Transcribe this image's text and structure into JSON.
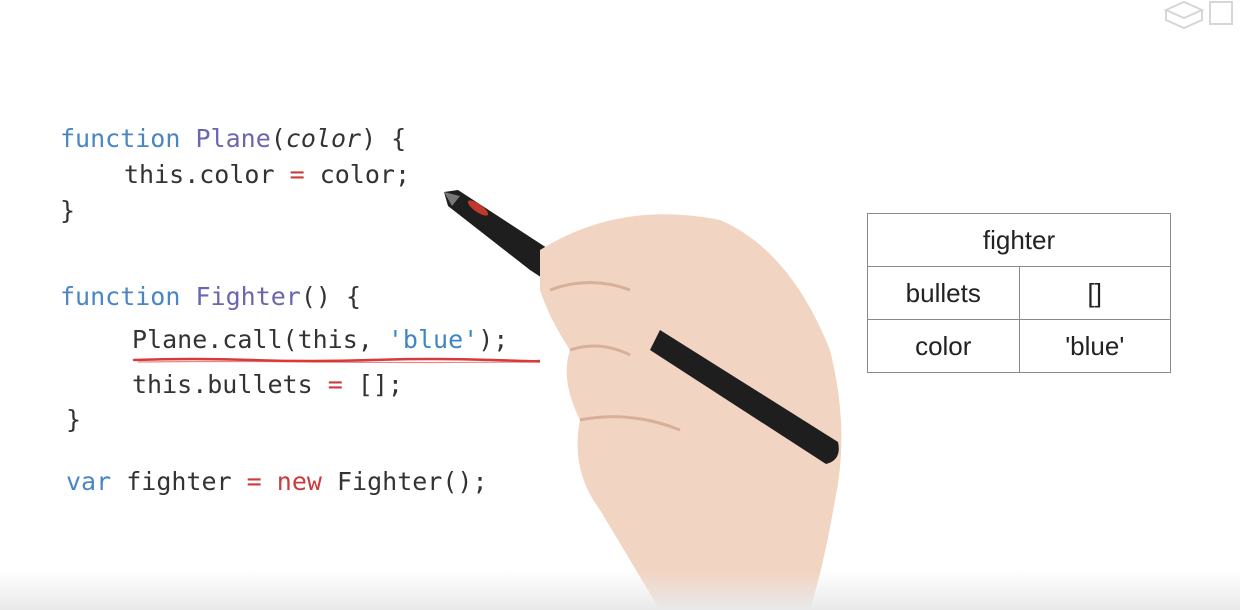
{
  "code": {
    "line1": {
      "kw": "function",
      "name": "Plane",
      "open": "(",
      "param": "color",
      "close": ") {"
    },
    "line2": {
      "lhs": "this.color",
      "op": "=",
      "rhs": "color;"
    },
    "line3": "}",
    "line4": {
      "kw": "function",
      "name": "Fighter",
      "rest": "() {"
    },
    "line5": {
      "pre": "Plane.call(this, ",
      "str": "'blue'",
      "post": ");"
    },
    "line6": {
      "lhs": "this.bullets",
      "op": "=",
      "rhs": "[];"
    },
    "line7": "}",
    "line8": {
      "kw": "var",
      "ident": "fighter",
      "op": "=",
      "new": "new",
      "rest": "Fighter();"
    }
  },
  "object_table": {
    "title": "fighter",
    "rows": [
      {
        "key": "bullets",
        "value": "[]"
      },
      {
        "key": "color",
        "value": "'blue'"
      }
    ]
  },
  "colors": {
    "keyword": "#4a86c4",
    "function_name": "#6b66b0",
    "operator": "#cc3b3b",
    "string": "#3f86c8",
    "underline": "#d83a3a"
  }
}
